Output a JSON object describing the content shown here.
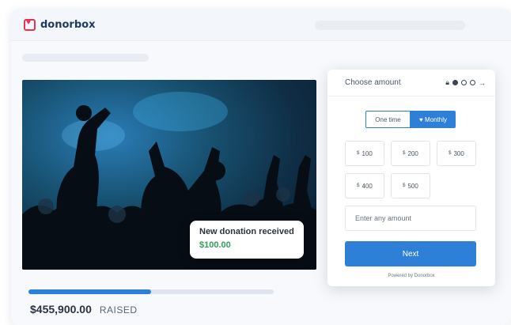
{
  "header": {
    "brand": "donorbox"
  },
  "hero": {
    "toast": {
      "title": "New donation received",
      "amount": "$100.00"
    }
  },
  "campaign": {
    "raised_amount": "$455,900.00",
    "raised_label": "RAISED",
    "progress_fraction": 0.5
  },
  "widget": {
    "title": "Choose amount",
    "frequency": {
      "one_time": "One time",
      "monthly": "♥ Monthly",
      "selected": "monthly"
    },
    "currency": "$",
    "amounts": [
      "100",
      "200",
      "300",
      "400",
      "500"
    ],
    "custom_placeholder": "Enter any amount",
    "next_label": "Next",
    "powered_by": "Powered by Donorbox",
    "step": 1,
    "steps_total": 3
  },
  "colors": {
    "accent": "#2e7fd8",
    "success": "#2f9e5a",
    "brand": "#e6334f"
  }
}
